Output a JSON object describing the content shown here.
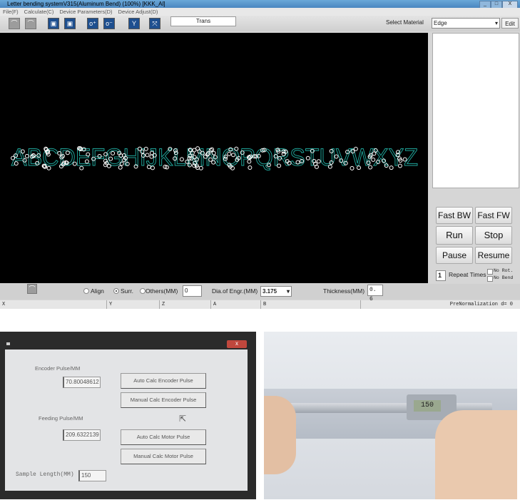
{
  "window": {
    "title": "Letter  bending systemV315(Aluminum Bend) (100%) [KKK_Al]",
    "controls": [
      "_",
      "□",
      "X"
    ]
  },
  "menu": [
    "File(F)",
    "Calculate(C)",
    "Device Parameters(D)",
    "Device Adjust(D)"
  ],
  "toolbar": {
    "mode_field": "Trans",
    "material_label": "Select Material",
    "material_value": "Edge",
    "edit_label": "Edit"
  },
  "canvas": {
    "letters": "ABCDEFGHIJKLMNOPQRSTUVWXYZ",
    "outline_color": "#1fa59a",
    "point_color": "#ffffff"
  },
  "controls": {
    "fast_bw": "Fast BW",
    "fast_fw": "Fast FW",
    "run": "Run",
    "stop": "Stop",
    "pause": "Pause",
    "resume": "Resume",
    "repeat_value": "1",
    "repeat_label": "Repeat Times",
    "no_rot": "No Rot.",
    "no_bend": "No Bend"
  },
  "bottom": {
    "align": "Align",
    "surr": "Surr.",
    "others": "Others(MM)",
    "others_value": "0",
    "dia_label": "Dia.of Engr.(MM)",
    "dia_value": "3.175",
    "thickness_label": "Thickness(MM)",
    "thickness_value": "0. 6",
    "selected_option": "Surr."
  },
  "status": {
    "x": "X",
    "y": "Y",
    "z": "Z",
    "a": "A",
    "b": "B",
    "info": "PreNormalization d= 0"
  },
  "dialog": {
    "close": "x",
    "encoder_label": "Encoder Pulse/MM",
    "encoder_value": "70.80048612",
    "auto_encoder": "Auto Calc Encoder Pulse",
    "manual_encoder": "Manual Calc Encoder Pulse",
    "feeding_label": "Feeding Pulse/MM",
    "feeding_value": "209.6322139",
    "auto_motor": "Auto Calc Motor Pulse",
    "manual_motor": "Manual Calc Motor Pulse",
    "sample_label": "Sample Length(MM)",
    "sample_value": "150"
  }
}
